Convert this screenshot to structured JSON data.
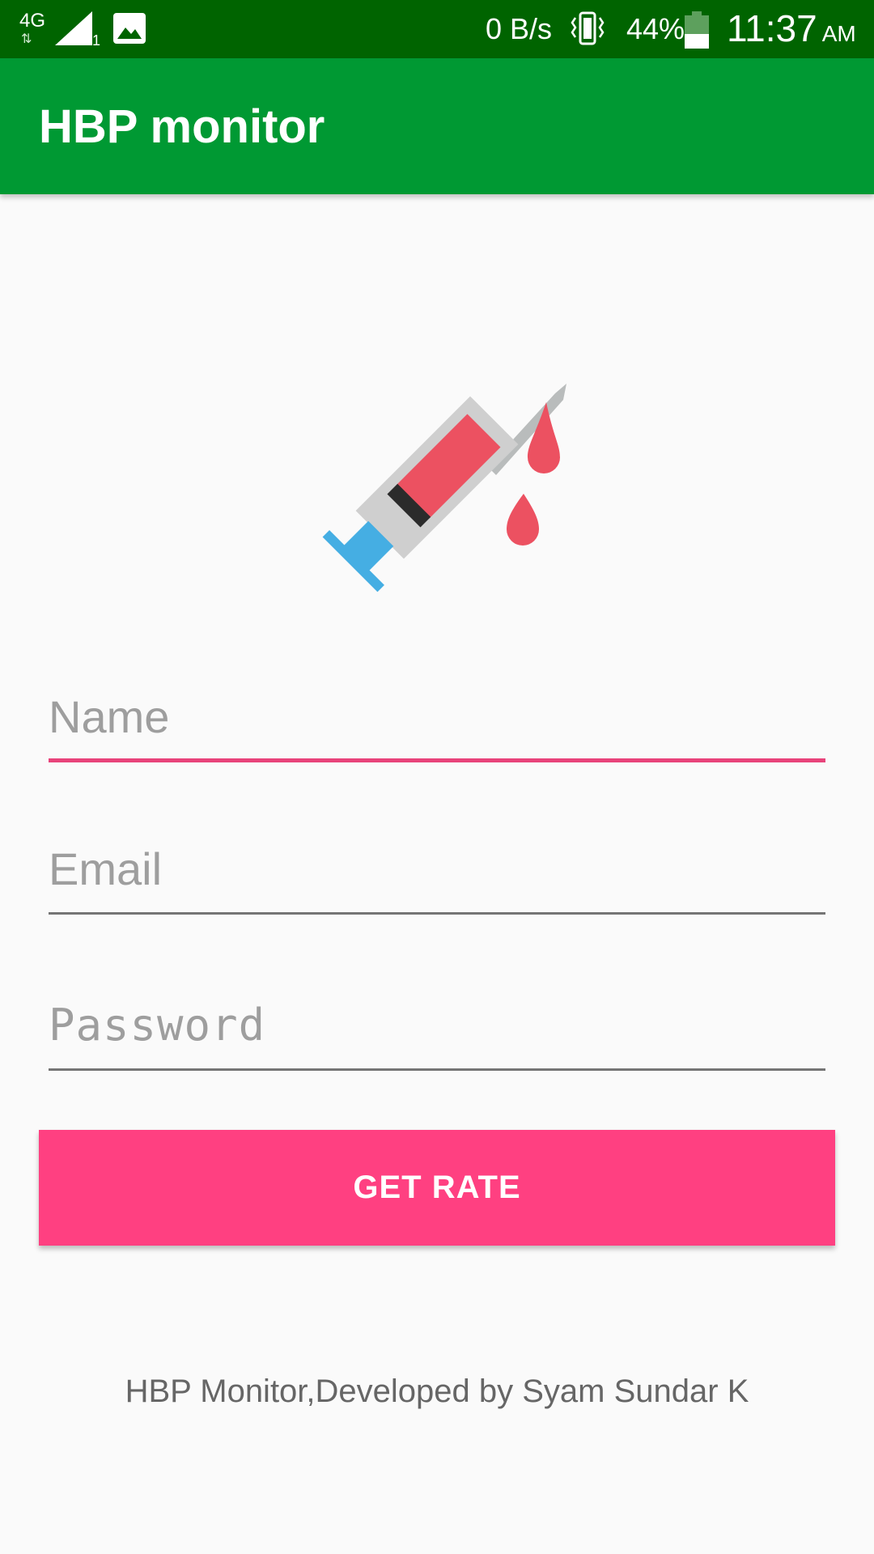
{
  "status_bar": {
    "network_type": "4G",
    "sim_number": "1",
    "data_speed": "0 B/s",
    "battery_percent": "44%",
    "battery_level": 0.44,
    "time": "11:37",
    "ampm": "AM",
    "icons": [
      "signal-icon",
      "gallery-icon",
      "vibrate-icon",
      "battery-icon"
    ]
  },
  "app_bar": {
    "title": "HBP monitor",
    "color": "#009933"
  },
  "logo": {
    "icon": "syringe-with-blood-drops-icon"
  },
  "form": {
    "name_placeholder": "Name",
    "email_placeholder": "Email",
    "password_placeholder": "Password",
    "focused_field": "name"
  },
  "button": {
    "label": "GET RATE",
    "color": "#ff4081"
  },
  "footer": {
    "text": "HBP Monitor,Developed by Syam Sundar K"
  },
  "colors": {
    "status_bar": "#006400",
    "accent": "#e8437a",
    "background": "#fafafa"
  }
}
